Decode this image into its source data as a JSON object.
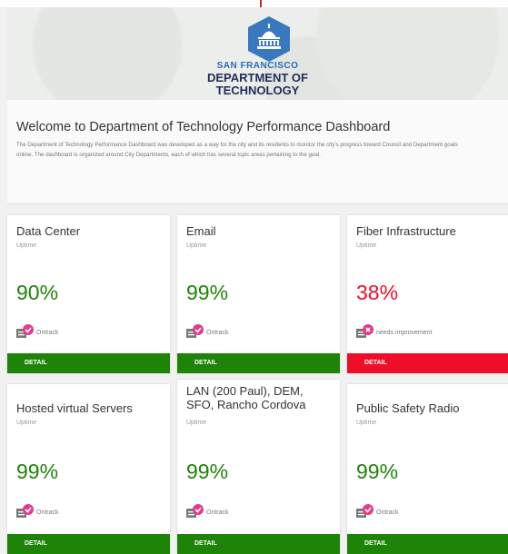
{
  "colors": {
    "ontrack": "#1e8407",
    "needs_improvement": "#ef0d28"
  },
  "header": {
    "logo_icon": "city-hall-icon",
    "org_line1": "SAN FRANCISCO",
    "org_line2": "DEPARTMENT OF",
    "org_line3": "TECHNOLOGY"
  },
  "intro": {
    "title": "Welcome to Department of Technology Performance Dashboard",
    "description": "The Department of Technology Performance Dashboard was developed as a way for the city and its residents to monitor the city's progress toward Council and Department goals online. The dashboard is organized around City Departments, each of which has several topic areas pertaining to the goal."
  },
  "cards": [
    {
      "title": "Data Center",
      "subtitle": "Uptime",
      "value": "90%",
      "status": "Ontrack",
      "button": "DETAIL"
    },
    {
      "title": "Email",
      "subtitle": "Uptime",
      "value": "99%",
      "status": "Ontrack",
      "button": "DETAIL"
    },
    {
      "title": "Fiber Infrastructure",
      "subtitle": "Uptime",
      "value": "38%",
      "status": "needs improvement",
      "button": "DETAIL"
    },
    {
      "title": "Hosted virtual Servers",
      "subtitle": "Uptime",
      "value": "99%",
      "status": "Ontrack",
      "button": "DETAIL"
    },
    {
      "title": "LAN (200 Paul), DEM, SFO, Rancho Cordova",
      "subtitle": "Uptime",
      "value": "99%",
      "status": "Ontrack",
      "button": "DETAIL"
    },
    {
      "title": "Public Safety Radio",
      "subtitle": "Uptime",
      "value": "99%",
      "status": "Ontrack",
      "button": "DETAIL"
    }
  ]
}
